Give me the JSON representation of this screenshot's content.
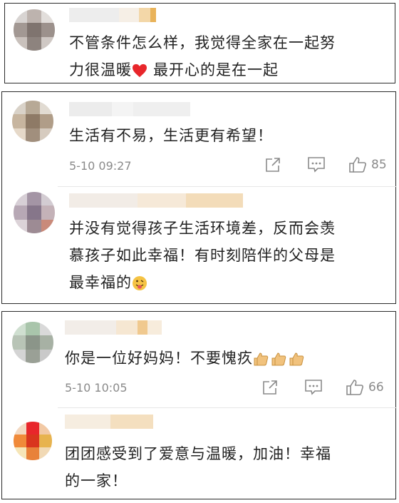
{
  "comments": {
    "c1": {
      "text_line1": "不管条件怎么样，我觉得全家在一起努",
      "text_line2": "力很温暖",
      "text_line2_tail": "最开心的是在一起",
      "emoji": "red-heart-icon"
    },
    "c2": {
      "text": "生活有不易，生活更有希望！",
      "time": "5-10 09:27",
      "likes": "85"
    },
    "c3": {
      "text_line1": "并没有觉得孩子生活环境差，反而会羡",
      "text_line2": "慕孩子如此幸福！有时刻陪伴的父母是",
      "text_line3": "最幸福的",
      "emoji": "tongue-out-face-icon"
    },
    "c4": {
      "text": "你是一位好妈妈！不要愧疚",
      "time": "5-10 10:05",
      "likes": "66",
      "emoji": "thumbs-up-emoji-icon"
    },
    "c5": {
      "text_line1": "团团感受到了爱意与温暖，加油！幸福",
      "text_line2": "的一家！"
    }
  },
  "colors": {
    "heart": "#e8262b",
    "meta": "#8a8a8a",
    "border": "#2b2b2b"
  }
}
